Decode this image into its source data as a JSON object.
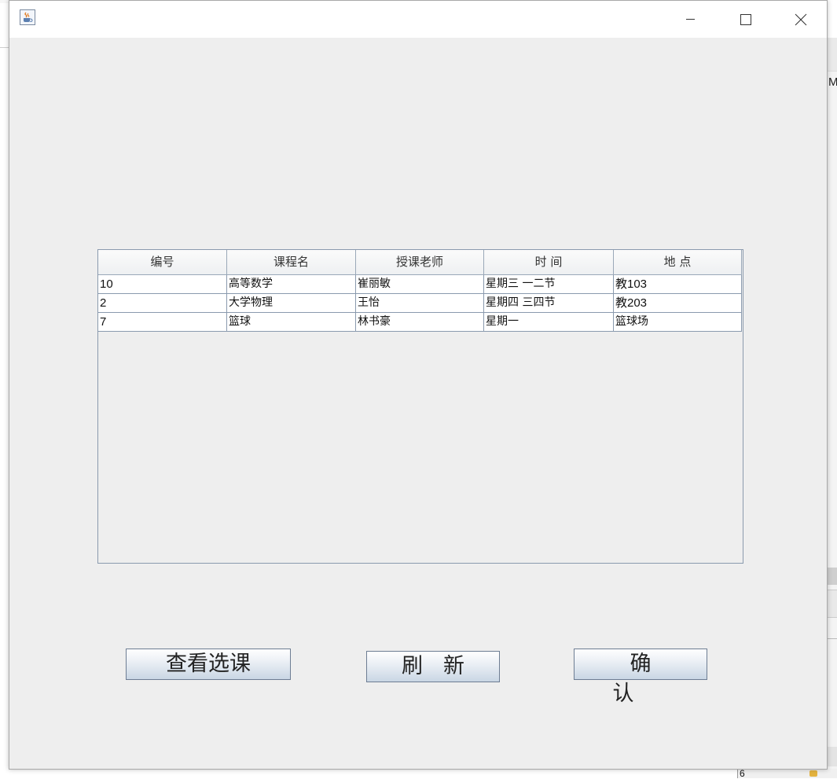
{
  "background": {
    "right_edge_text": "M",
    "bottom_number": "6"
  },
  "titlebar": {
    "icon": "java-cup-icon",
    "controls": {
      "minimize_icon": "minimize-icon",
      "maximize_icon": "maximize-icon",
      "close_icon": "close-icon"
    }
  },
  "table": {
    "columns": [
      "编号",
      "课程名",
      "授课老师",
      "时 间",
      "地 点"
    ],
    "rows": [
      [
        "10",
        "高等数学",
        "崔丽敏",
        "星期三 一二节",
        "教103"
      ],
      [
        "2",
        "大学物理",
        "王怡",
        "星期四 三四节",
        "教203"
      ],
      [
        "7",
        "篮球",
        "林书豪",
        "星期一",
        "篮球场"
      ]
    ]
  },
  "buttons": {
    "view_selected": "查看选课",
    "refresh": "刷新",
    "confirm": "确认"
  },
  "colors": {
    "window_bg": "#eeeeee",
    "grid_line": "#8a9aae",
    "button_border": "#6d7d93"
  }
}
